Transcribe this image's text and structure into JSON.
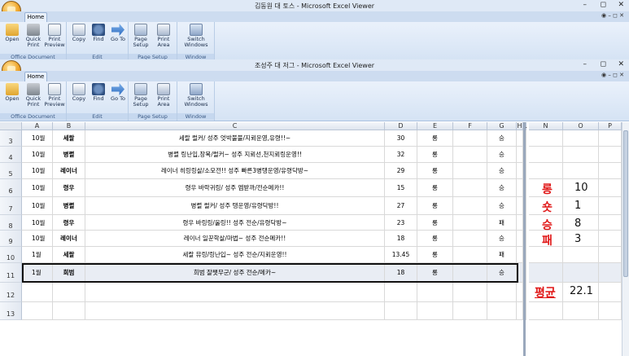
{
  "back_window": {
    "title": "김동원 대 토스 - Microsoft Excel Viewer",
    "tab": "Home",
    "groups": [
      "Office Document",
      "Edit",
      "Page Setup",
      "Window"
    ],
    "buttons": [
      "Open",
      "Quick Print",
      "Print Preview",
      "Copy",
      "Find",
      "Go To",
      "Page Setup",
      "Print Area",
      "Switch Windows"
    ]
  },
  "front_window": {
    "title": "조성주 대 저그 - Microsoft Excel Viewer",
    "tab": "Home",
    "groups": [
      "Office Document",
      "Edit",
      "Page Setup",
      "Window"
    ],
    "buttons": {
      "open": "Open",
      "quick_print": "Quick Print",
      "print_preview": "Print Preview",
      "copy": "Copy",
      "find": "Find",
      "goto": "Go To",
      "page_setup": "Page Setup",
      "print_area": "Print Area",
      "switch_windows": "Switch Windows"
    },
    "controls": {
      "min": "–",
      "max": "◻",
      "close": "✕"
    }
  },
  "sheet": {
    "columns": [
      "A",
      "B",
      "C",
      "D",
      "E",
      "F",
      "G",
      "H",
      "L",
      "N",
      "O",
      "P"
    ],
    "rows": [
      {
        "n": "3",
        "a": "10월",
        "b": "세랄",
        "c": "세랄 럴커/ 성주 엇박불불/지뢰운영,유령!!~",
        "d": "30",
        "e": "롱",
        "g": "승"
      },
      {
        "n": "4",
        "a": "10월",
        "b": "병렬",
        "c": "병렬 링난입,장복/럴커~ 성주 지뢰선,천지뢰링운영!!",
        "d": "32",
        "e": "롱",
        "g": "승"
      },
      {
        "n": "5",
        "a": "10월",
        "b": "레이너",
        "c": "레이너 히링링살/소모전!! 성주 빠른3병탱운영/유령닥방~",
        "d": "29",
        "e": "롱",
        "g": "승"
      },
      {
        "n": "6",
        "a": "10월",
        "b": "령우",
        "c": "령우 바락귀링/ 성주 엠받까/전순메카!!",
        "d": "15",
        "e": "롱",
        "g": "승"
      },
      {
        "n": "7",
        "a": "10월",
        "b": "병렬",
        "c": "병렬 럴커/ 성주 탱운영/유령닥방!!",
        "d": "27",
        "e": "롱",
        "g": "승"
      },
      {
        "n": "8",
        "a": "10월",
        "b": "령우",
        "c": "령우 바링링/울링!! 성주 전순/유령닥방~",
        "d": "23",
        "e": "롱",
        "g": "패"
      },
      {
        "n": "9",
        "a": "10월",
        "b": "레이너",
        "c": "레이너 일꾼학살/마법~ 성주 전순메카!!",
        "d": "18",
        "e": "롱",
        "g": "승"
      },
      {
        "n": "10",
        "a": "1월",
        "b": "세랄",
        "c": "세랄 뮤링/링난입~ 성주 전순/지뢰운영!!",
        "d": "13.45",
        "e": "롱",
        "g": "패"
      },
      {
        "n": "11",
        "a": "1월",
        "b": "희범",
        "c": "희범 잘쨋무군/ 성주 전순/메카~",
        "d": "18",
        "e": "롱",
        "g": "승"
      },
      {
        "n": "12",
        "a": "",
        "b": "",
        "c": "",
        "d": "",
        "e": "",
        "g": ""
      },
      {
        "n": "13",
        "a": "",
        "b": "",
        "c": "",
        "d": "",
        "e": "",
        "g": ""
      }
    ],
    "stats": [
      {
        "label": "롱",
        "value": "10"
      },
      {
        "label": "숏",
        "value": "1"
      },
      {
        "label": "승",
        "value": "8"
      },
      {
        "label": "패",
        "value": "3"
      }
    ],
    "average": {
      "label": "평균",
      "value": "22.1"
    }
  },
  "colors": {
    "accent_red": "#e01616",
    "ribbon": "#d5e3f4"
  }
}
